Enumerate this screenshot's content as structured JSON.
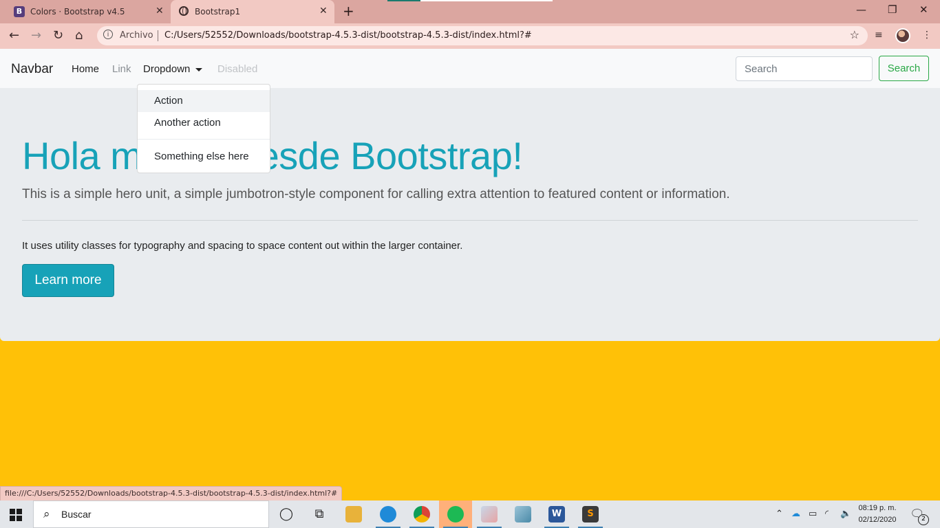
{
  "browser": {
    "tabs": [
      {
        "title": "Colors · Bootstrap v4.5",
        "favicon": "B",
        "active": false
      },
      {
        "title": "Bootstrap1",
        "active": true
      }
    ],
    "omnibox": {
      "security_label": "Archivo",
      "url": "C:/Users/52552/Downloads/bootstrap-4.5.3-dist/bootstrap-4.5.3-dist/index.html?#"
    },
    "status_url": "file:///C:/Users/52552/Downloads/bootstrap-4.5.3-dist/bootstrap-4.5.3-dist/index.html?#"
  },
  "navbar": {
    "brand": "Navbar",
    "items": [
      {
        "label": "Home"
      },
      {
        "label": "Link"
      },
      {
        "label": "Dropdown"
      },
      {
        "label": "Disabled"
      }
    ],
    "search_placeholder": "Search",
    "search_button": "Search"
  },
  "dropdown": {
    "items": [
      "Action",
      "Another action",
      "Something else here"
    ]
  },
  "jumbotron": {
    "title": "Hola mundo desde Bootstrap!",
    "lead": "This is a simple hero unit, a simple jumbotron-style component for calling extra attention to featured content or information.",
    "text": "It uses utility classes for typography and spacing to space content out within the larger container.",
    "button": "Learn more"
  },
  "taskbar": {
    "search_text": "Buscar",
    "time": "08:19 p. m.",
    "date": "02/12/2020",
    "notification_count": "2"
  },
  "colors": {
    "page_bg": "#ffc107",
    "jumbotron_bg": "#e9ecef",
    "primary_text": "#17a2b8",
    "success": "#28a745",
    "chrome_tab": "#dba6a0"
  }
}
